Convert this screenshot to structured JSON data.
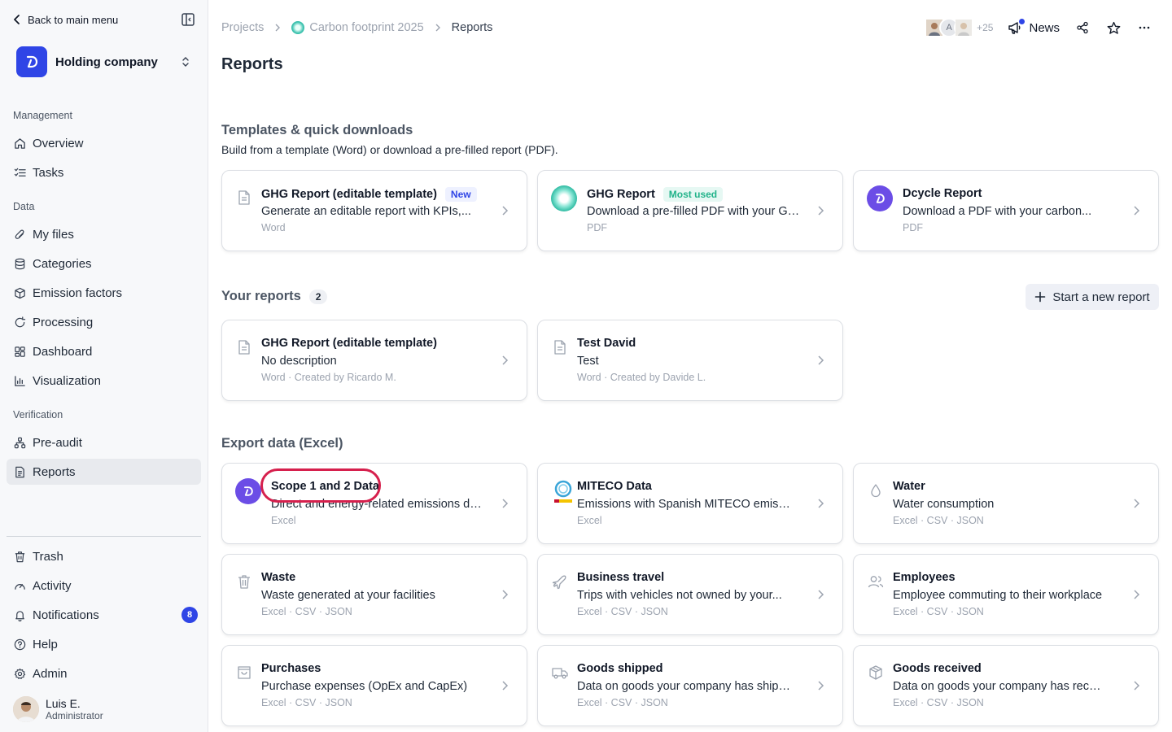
{
  "sidebar": {
    "back_label": "Back to main menu",
    "org_name": "Holding company",
    "sections": {
      "management": "Management",
      "data": "Data",
      "verification": "Verification"
    },
    "items": {
      "overview": "Overview",
      "tasks": "Tasks",
      "my_files": "My files",
      "categories": "Categories",
      "emission_factors": "Emission factors",
      "processing": "Processing",
      "dashboard": "Dashboard",
      "visualization": "Visualization",
      "pre_audit": "Pre-audit",
      "reports": "Reports",
      "trash": "Trash",
      "activity": "Activity",
      "notifications": "Notifications",
      "help": "Help",
      "admin": "Admin"
    },
    "notifications_count": "8",
    "user": {
      "name": "Luis E.",
      "role": "Administrator"
    }
  },
  "breadcrumb": {
    "projects": "Projects",
    "project": "Carbon footprint 2025",
    "current": "Reports"
  },
  "header": {
    "avatar_letter": "A",
    "extra_members": "+25",
    "news_label": "News"
  },
  "page_title": "Reports",
  "templates": {
    "heading": "Templates & quick downloads",
    "subtitle": "Build from a template (Word) or download a pre-filled report (PDF).",
    "cards": [
      {
        "title": "GHG Report (editable template)",
        "tag": "New",
        "desc": "Generate an editable report with KPIs,...",
        "meta": "Word"
      },
      {
        "title": "GHG Report",
        "tag": "Most used",
        "desc": "Download a pre-filled PDF with your GH...",
        "meta": "PDF"
      },
      {
        "title": "Dcycle Report",
        "desc": "Download a PDF with your carbon...",
        "meta": "PDF"
      }
    ]
  },
  "your_reports": {
    "heading": "Your reports",
    "count": "2",
    "new_button": "Start a new report",
    "cards": [
      {
        "title": "GHG Report (editable template)",
        "desc": "No description",
        "meta": "Word · Created by Ricardo M."
      },
      {
        "title": "Test David",
        "desc": "Test",
        "meta": "Word · Created by Davide L."
      }
    ]
  },
  "export": {
    "heading": "Export data (Excel)",
    "cards": [
      {
        "title": "Scope 1 and 2 Data",
        "desc": "Direct and energy-related emissions dat...",
        "meta": "Excel"
      },
      {
        "title": "MITECO Data",
        "desc": "Emissions with Spanish MITECO emissio...",
        "meta": "Excel"
      },
      {
        "title": "Water",
        "desc": "Water consumption",
        "meta": "Excel · CSV · JSON"
      },
      {
        "title": "Waste",
        "desc": "Waste generated at your facilities",
        "meta": "Excel · CSV · JSON"
      },
      {
        "title": "Business travel",
        "desc": "Trips with vehicles not owned by your...",
        "meta": "Excel · CSV · JSON"
      },
      {
        "title": "Employees",
        "desc": "Employee commuting to their workplace",
        "meta": "Excel · CSV · JSON"
      },
      {
        "title": "Purchases",
        "desc": "Purchase expenses (OpEx and CapEx)",
        "meta": "Excel · CSV · JSON"
      },
      {
        "title": "Goods shipped",
        "desc": "Data on goods your company has shipped",
        "meta": "Excel · CSV · JSON"
      },
      {
        "title": "Goods received",
        "desc": "Data on goods your company has received",
        "meta": "Excel · CSV · JSON"
      }
    ]
  },
  "colors": {
    "brand": "#2f45e6",
    "dcycle_purple": "#6b4de6",
    "highlight": "#d6204d",
    "new_tag": "#2f45e6",
    "most_used_tag": "#22b38a"
  }
}
